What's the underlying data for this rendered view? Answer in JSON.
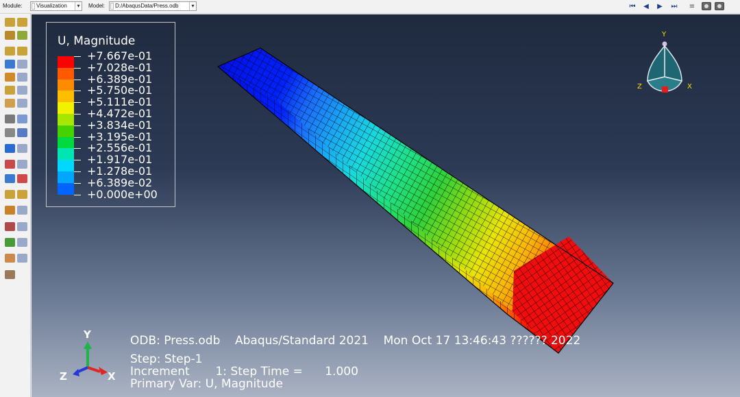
{
  "toolbar": {
    "module_label": "Module:",
    "module_value": "Visualization",
    "model_label": "Model:",
    "model_value": "D:/AbaqusData/Press.odb"
  },
  "legend": {
    "title": "U, Magnitude",
    "entries": [
      {
        "value": "+7.667e-01",
        "color": "#ff0000"
      },
      {
        "value": "+7.028e-01",
        "color": "#ff5a00"
      },
      {
        "value": "+6.389e-01",
        "color": "#ff8c00"
      },
      {
        "value": "+5.750e-01",
        "color": "#ffbf00"
      },
      {
        "value": "+5.111e-01",
        "color": "#f2f200"
      },
      {
        "value": "+4.472e-01",
        "color": "#a6e600"
      },
      {
        "value": "+3.834e-01",
        "color": "#46d100"
      },
      {
        "value": "+3.195e-01",
        "color": "#00d940"
      },
      {
        "value": "+2.556e-01",
        "color": "#00e6b3"
      },
      {
        "value": "+1.917e-01",
        "color": "#00d9ff"
      },
      {
        "value": "+1.278e-01",
        "color": "#00a6ff"
      },
      {
        "value": "+6.389e-02",
        "color": "#0064ff"
      },
      {
        "value": "+0.000e+00",
        "color": "#0000ff"
      }
    ]
  },
  "info": {
    "line1": "ODB: Press.odb    Abaqus/Standard 2021    Mon Oct 17 13:46:43 ?????? 2022",
    "line2": "Step: Step-1",
    "line3": "Increment       1: Step Time =      1.000",
    "line4": "Primary Var: U, Magnitude"
  },
  "triad": {
    "x": "X",
    "y": "Y",
    "z": "Z"
  },
  "view_cube": {
    "x": "X",
    "y": "Y",
    "z": "Z"
  }
}
